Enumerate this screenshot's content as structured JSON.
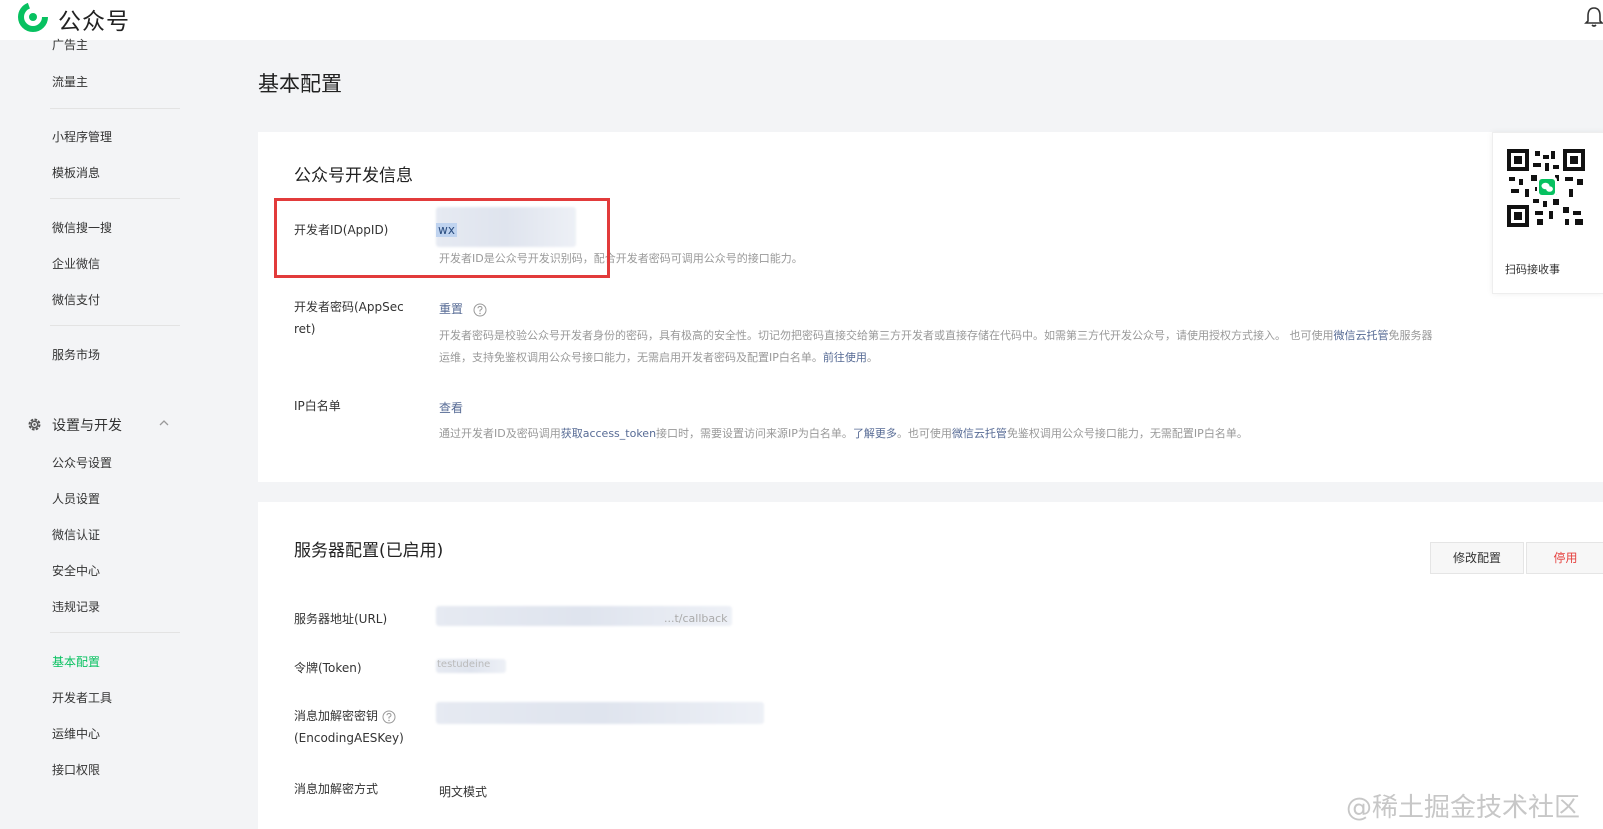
{
  "header": {
    "brand": "公众号"
  },
  "sidebar": {
    "items_top": [
      "广告主",
      "流量主",
      "小程序管理",
      "模板消息",
      "微信搜一搜",
      "企业微信",
      "微信支付",
      "服务市场"
    ],
    "section": {
      "label": "设置与开发"
    },
    "items_dev": [
      "公众号设置",
      "人员设置",
      "微信认证",
      "安全中心",
      "违规记录",
      "基本配置",
      "开发者工具",
      "运维中心",
      "接口权限"
    ],
    "active": "基本配置"
  },
  "main": {
    "title": "基本配置",
    "dev_info": {
      "title": "公众号开发信息",
      "appid": {
        "label": "开发者ID(AppID)",
        "value": "wx",
        "desc_a": "开发者ID是公众号开发识别码，",
        "desc_b": "配合开发者密码可调用公众号的接口能力。"
      },
      "appsecret": {
        "label_line1": "开发者密码(AppSec",
        "label_line2": "ret)",
        "action": "重置",
        "desc1_prefix": "开发者密码是校验公众号开发者身份的密码，具有极高的安全性。切记勿把密码直接交给第三方开发者或直接存储在代码中。如需第三方代开发公众号，请使用授权方式接入。 也可使用",
        "desc1_link": "微信云托管",
        "desc1_suffix": "免服务器",
        "desc2_prefix": "运维，支持免鉴权调用公众号接口能力，无需启用开发者密码及配置IP白名单。",
        "desc2_link": "前往使用",
        "desc2_suffix": "。"
      },
      "ip_whitelist": {
        "label": "IP白名单",
        "action": "查看",
        "desc_p1": "通过开发者ID及密码调用",
        "desc_link1": "获取access_token",
        "desc_p2": "接口时，需要设置访问来源IP为白名单。",
        "desc_link2": "了解更多",
        "desc_p3": "。也可使用",
        "desc_link3": "微信云托管",
        "desc_p4": "免鉴权调用公众号接口能力，无需配置IP白名单。"
      }
    },
    "server_config": {
      "title": "服务器配置(已启用)",
      "edit_button": "修改配置",
      "stop_button": "停用",
      "url_label": "服务器地址(URL)",
      "url_value": "...t/callback",
      "token_label": "令牌(Token)",
      "token_value": "testudeine",
      "aes_label_line1": "消息加解密密钥",
      "aes_label_line2": "(EncodingAESKey)",
      "mode_label": "消息加解密方式",
      "mode_value": "明文模式"
    }
  },
  "qr_panel": {
    "caption": "扫码接收事"
  },
  "watermark": "@稀土掘金技术社区",
  "colors": {
    "brand_green": "#07c160",
    "link": "#576b95",
    "danger": "#e64340",
    "red_box": "#e23b3b"
  }
}
